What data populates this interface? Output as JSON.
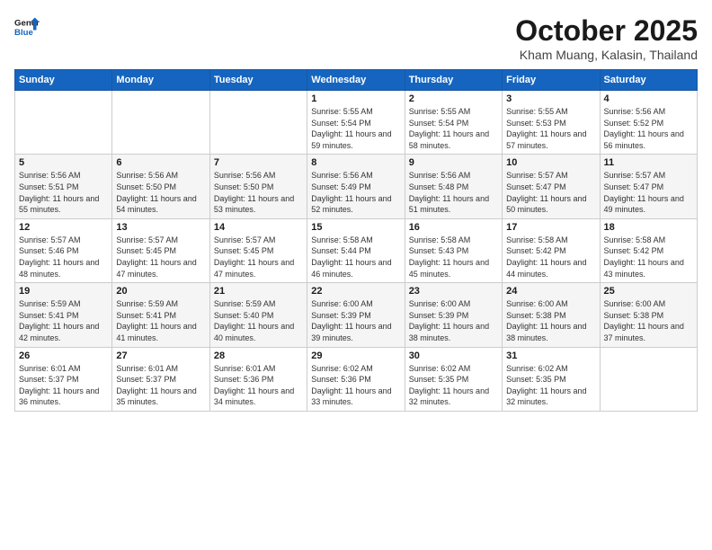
{
  "header": {
    "logo_line1": "General",
    "logo_line2": "Blue",
    "month_title": "October 2025",
    "subtitle": "Kham Muang, Kalasin, Thailand"
  },
  "weekdays": [
    "Sunday",
    "Monday",
    "Tuesday",
    "Wednesday",
    "Thursday",
    "Friday",
    "Saturday"
  ],
  "weeks": [
    [
      {
        "day": "",
        "info": ""
      },
      {
        "day": "",
        "info": ""
      },
      {
        "day": "",
        "info": ""
      },
      {
        "day": "1",
        "info": "Sunrise: 5:55 AM\nSunset: 5:54 PM\nDaylight: 11 hours and 59 minutes."
      },
      {
        "day": "2",
        "info": "Sunrise: 5:55 AM\nSunset: 5:54 PM\nDaylight: 11 hours and 58 minutes."
      },
      {
        "day": "3",
        "info": "Sunrise: 5:55 AM\nSunset: 5:53 PM\nDaylight: 11 hours and 57 minutes."
      },
      {
        "day": "4",
        "info": "Sunrise: 5:56 AM\nSunset: 5:52 PM\nDaylight: 11 hours and 56 minutes."
      }
    ],
    [
      {
        "day": "5",
        "info": "Sunrise: 5:56 AM\nSunset: 5:51 PM\nDaylight: 11 hours and 55 minutes."
      },
      {
        "day": "6",
        "info": "Sunrise: 5:56 AM\nSunset: 5:50 PM\nDaylight: 11 hours and 54 minutes."
      },
      {
        "day": "7",
        "info": "Sunrise: 5:56 AM\nSunset: 5:50 PM\nDaylight: 11 hours and 53 minutes."
      },
      {
        "day": "8",
        "info": "Sunrise: 5:56 AM\nSunset: 5:49 PM\nDaylight: 11 hours and 52 minutes."
      },
      {
        "day": "9",
        "info": "Sunrise: 5:56 AM\nSunset: 5:48 PM\nDaylight: 11 hours and 51 minutes."
      },
      {
        "day": "10",
        "info": "Sunrise: 5:57 AM\nSunset: 5:47 PM\nDaylight: 11 hours and 50 minutes."
      },
      {
        "day": "11",
        "info": "Sunrise: 5:57 AM\nSunset: 5:47 PM\nDaylight: 11 hours and 49 minutes."
      }
    ],
    [
      {
        "day": "12",
        "info": "Sunrise: 5:57 AM\nSunset: 5:46 PM\nDaylight: 11 hours and 48 minutes."
      },
      {
        "day": "13",
        "info": "Sunrise: 5:57 AM\nSunset: 5:45 PM\nDaylight: 11 hours and 47 minutes."
      },
      {
        "day": "14",
        "info": "Sunrise: 5:57 AM\nSunset: 5:45 PM\nDaylight: 11 hours and 47 minutes."
      },
      {
        "day": "15",
        "info": "Sunrise: 5:58 AM\nSunset: 5:44 PM\nDaylight: 11 hours and 46 minutes."
      },
      {
        "day": "16",
        "info": "Sunrise: 5:58 AM\nSunset: 5:43 PM\nDaylight: 11 hours and 45 minutes."
      },
      {
        "day": "17",
        "info": "Sunrise: 5:58 AM\nSunset: 5:42 PM\nDaylight: 11 hours and 44 minutes."
      },
      {
        "day": "18",
        "info": "Sunrise: 5:58 AM\nSunset: 5:42 PM\nDaylight: 11 hours and 43 minutes."
      }
    ],
    [
      {
        "day": "19",
        "info": "Sunrise: 5:59 AM\nSunset: 5:41 PM\nDaylight: 11 hours and 42 minutes."
      },
      {
        "day": "20",
        "info": "Sunrise: 5:59 AM\nSunset: 5:41 PM\nDaylight: 11 hours and 41 minutes."
      },
      {
        "day": "21",
        "info": "Sunrise: 5:59 AM\nSunset: 5:40 PM\nDaylight: 11 hours and 40 minutes."
      },
      {
        "day": "22",
        "info": "Sunrise: 6:00 AM\nSunset: 5:39 PM\nDaylight: 11 hours and 39 minutes."
      },
      {
        "day": "23",
        "info": "Sunrise: 6:00 AM\nSunset: 5:39 PM\nDaylight: 11 hours and 38 minutes."
      },
      {
        "day": "24",
        "info": "Sunrise: 6:00 AM\nSunset: 5:38 PM\nDaylight: 11 hours and 38 minutes."
      },
      {
        "day": "25",
        "info": "Sunrise: 6:00 AM\nSunset: 5:38 PM\nDaylight: 11 hours and 37 minutes."
      }
    ],
    [
      {
        "day": "26",
        "info": "Sunrise: 6:01 AM\nSunset: 5:37 PM\nDaylight: 11 hours and 36 minutes."
      },
      {
        "day": "27",
        "info": "Sunrise: 6:01 AM\nSunset: 5:37 PM\nDaylight: 11 hours and 35 minutes."
      },
      {
        "day": "28",
        "info": "Sunrise: 6:01 AM\nSunset: 5:36 PM\nDaylight: 11 hours and 34 minutes."
      },
      {
        "day": "29",
        "info": "Sunrise: 6:02 AM\nSunset: 5:36 PM\nDaylight: 11 hours and 33 minutes."
      },
      {
        "day": "30",
        "info": "Sunrise: 6:02 AM\nSunset: 5:35 PM\nDaylight: 11 hours and 32 minutes."
      },
      {
        "day": "31",
        "info": "Sunrise: 6:02 AM\nSunset: 5:35 PM\nDaylight: 11 hours and 32 minutes."
      },
      {
        "day": "",
        "info": ""
      }
    ]
  ]
}
